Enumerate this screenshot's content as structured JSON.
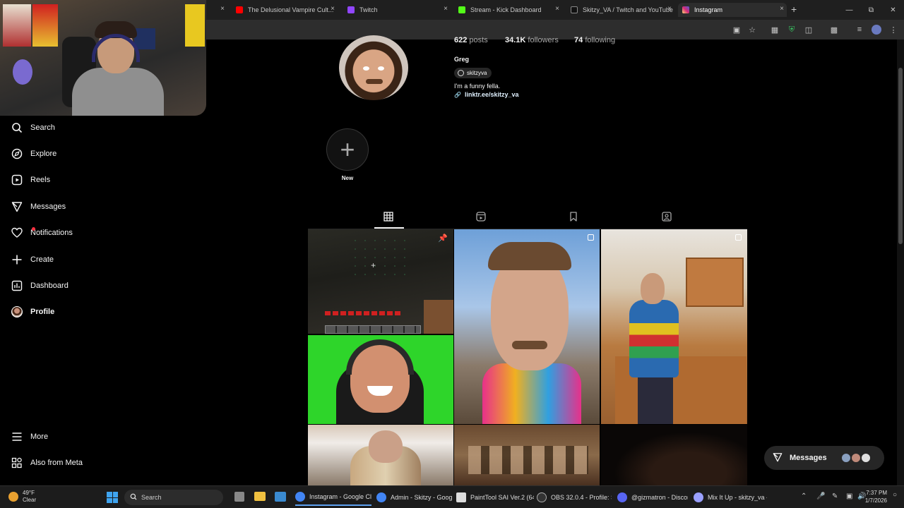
{
  "browser": {
    "tabs": [
      {
        "label": "The Delusional Vampire Cult...",
        "favicon_color": "#ff0000"
      },
      {
        "label": "Twitch",
        "favicon_color": "#9146ff"
      },
      {
        "label": "Stream - Kick Dashboard",
        "favicon_color": "#53fc18"
      },
      {
        "label": "Skitzy_VA / Twitch and YouTube",
        "favicon_color": "#111111"
      },
      {
        "label": "Instagram",
        "favicon_color": "#d6249f"
      }
    ],
    "new_tab_symbol": "+",
    "close_symbol": "×"
  },
  "sidebar": {
    "items": [
      {
        "label": "Search",
        "icon": "search-icon"
      },
      {
        "label": "Explore",
        "icon": "compass-icon"
      },
      {
        "label": "Reels",
        "icon": "reels-icon"
      },
      {
        "label": "Messages",
        "icon": "send-icon"
      },
      {
        "label": "Notifications",
        "icon": "heart-icon"
      },
      {
        "label": "Create",
        "icon": "plus-icon"
      },
      {
        "label": "Dashboard",
        "icon": "chart-icon"
      },
      {
        "label": "Profile",
        "icon": "avatar"
      }
    ],
    "bottom": [
      {
        "label": "More",
        "icon": "menu-icon"
      },
      {
        "label": "Also from Meta",
        "icon": "meta-grid-icon"
      }
    ]
  },
  "profile": {
    "posts_count": "622",
    "posts_label": "posts",
    "followers_count": "34.1K",
    "followers_label": "followers",
    "following_count": "74",
    "following_label": "following",
    "name": "Greg",
    "threads_handle": "skitzyva",
    "bio": "I'm a funny fella.",
    "link": "linktr.ee/skitzy_va",
    "highlight_new_label": "New"
  },
  "messages_button": {
    "label": "Messages"
  },
  "taskbar": {
    "weather_temp": "49°F",
    "weather_desc": "Clear",
    "search_label": "Search",
    "apps": [
      {
        "label": "Instagram - Google Cl",
        "color": "#4285f4"
      },
      {
        "label": "Admin - Skitzy - Goog",
        "color": "#4285f4"
      },
      {
        "label": "PaintTool SAI Ver.2 (64",
        "color": "#dddddd"
      },
      {
        "label": "OBS 32.0.4 - Profile: St",
        "color": "#333333"
      },
      {
        "label": "@gizmatron - Discor",
        "color": "#5865f2"
      },
      {
        "label": "Mix It Up - skitzy_va -",
        "color": "#9aa0ff"
      }
    ],
    "time": "7:37 PM",
    "date": "1/7/2026"
  }
}
